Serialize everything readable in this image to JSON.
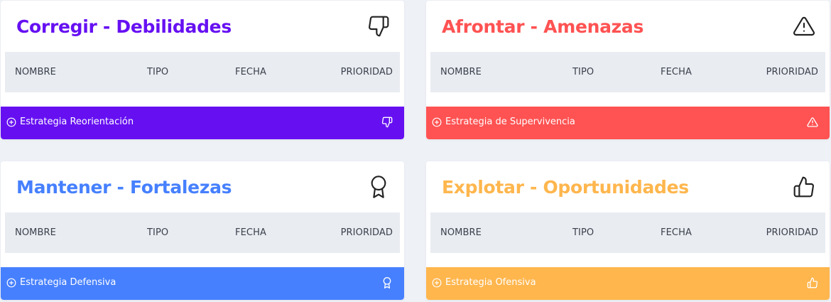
{
  "columns": {
    "nombre": "NOMBRE",
    "tipo": "TIPO",
    "fecha": "FECHA",
    "prioridad": "PRIORIDAD"
  },
  "cards": {
    "debilidades": {
      "title": "Corregir - Debilidades",
      "footer_label": "Estrategia Reorientación",
      "icon": "thumbs-down-icon",
      "color": "#6610f2"
    },
    "amenazas": {
      "title": "Afrontar - Amenazas",
      "footer_label": "Estrategia de Supervivencia",
      "icon": "warning-triangle-icon",
      "color": "#ff5252"
    },
    "fortalezas": {
      "title": "Mantener - Fortalezas",
      "footer_label": "Estrategia Defensiva",
      "icon": "award-icon",
      "color": "#4680ff"
    },
    "oportunidades": {
      "title": "Explotar - Oportunidades",
      "footer_label": "Estrategia Ofensiva",
      "icon": "thumbs-up-icon",
      "color": "#ffb64d"
    }
  }
}
